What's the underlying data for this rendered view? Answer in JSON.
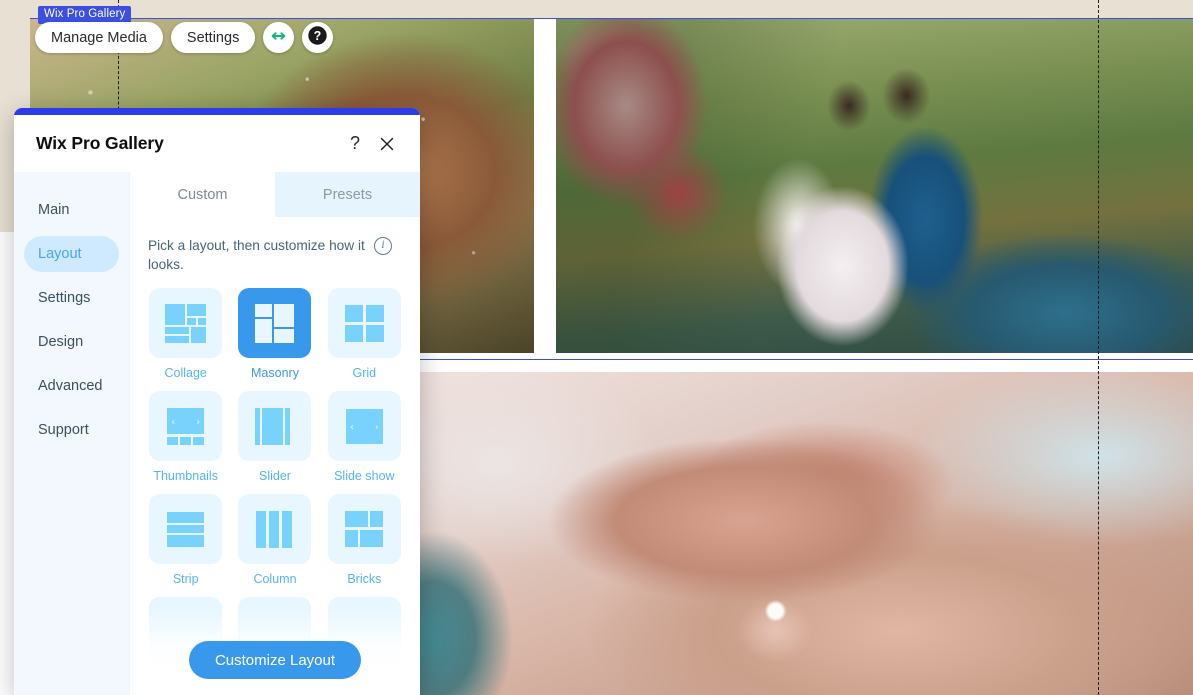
{
  "editor": {
    "component_tag": "Wix Pro Gallery",
    "toolbar": {
      "manage_media_label": "Manage Media",
      "settings_label": "Settings",
      "stretch_icon": "horizontal-resize-icon",
      "help_icon": "help-circle-icon",
      "stretch_color": "#13b878"
    }
  },
  "modal": {
    "title": "Wix Pro Gallery",
    "help_label": "?",
    "close_label": "✕",
    "accent_bar_color": "#2b3ce8",
    "sidebar": {
      "items": [
        {
          "label": "Main",
          "active": false
        },
        {
          "label": "Layout",
          "active": true
        },
        {
          "label": "Settings",
          "active": false
        },
        {
          "label": "Design",
          "active": false
        },
        {
          "label": "Advanced",
          "active": false
        },
        {
          "label": "Support",
          "active": false
        }
      ]
    },
    "tabs": [
      {
        "label": "Custom",
        "active": true
      },
      {
        "label": "Presets",
        "active": false
      }
    ],
    "hint": {
      "text": "Pick a layout, then customize how it looks.",
      "info_icon": "info-circle-icon"
    },
    "layouts": [
      {
        "label": "Collage",
        "selected": false
      },
      {
        "label": "Masonry",
        "selected": true
      },
      {
        "label": "Grid",
        "selected": false
      },
      {
        "label": "Thumbnails",
        "selected": false
      },
      {
        "label": "Slider",
        "selected": false
      },
      {
        "label": "Slide show",
        "selected": false
      },
      {
        "label": "Strip",
        "selected": false
      },
      {
        "label": "Column",
        "selected": false
      },
      {
        "label": "Bricks",
        "selected": false
      }
    ],
    "cta_label": "Customize Layout",
    "colors": {
      "accent": "#3899ec",
      "tile": "#79d2fb",
      "tile_bg": "#e7f6ff",
      "sidebar_bg": "#f2f8fe",
      "sidebar_active_bg": "#cfeaff"
    }
  }
}
